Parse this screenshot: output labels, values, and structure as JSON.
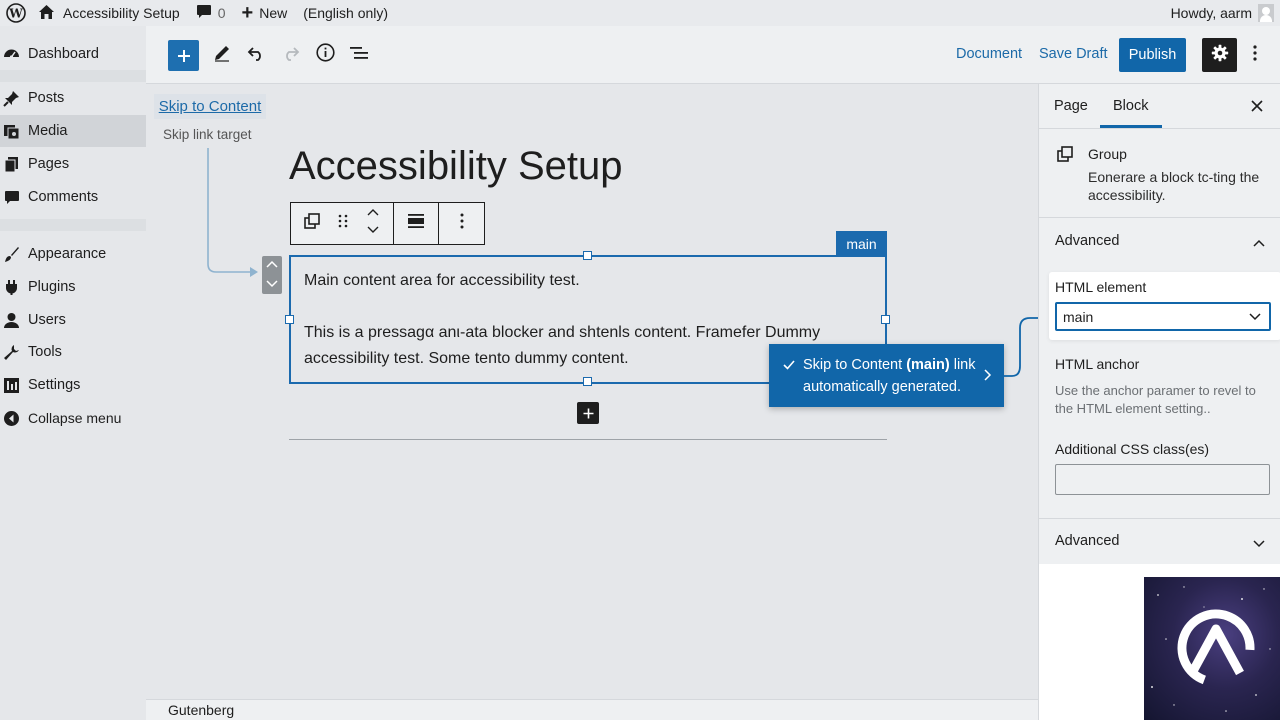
{
  "admin_bar": {
    "site_name": "Accessibility Setup",
    "comments_count": "0",
    "new_label": "New",
    "language_note": "(English only)",
    "greeting": "Howdy, aarm"
  },
  "admin_menu": {
    "items": [
      {
        "label": "Dashboard",
        "icon": "dashboard-icon"
      },
      {
        "label": "Posts",
        "icon": "pin-icon"
      },
      {
        "label": "Media",
        "icon": "media-icon"
      },
      {
        "label": "Pages",
        "icon": "pages-icon"
      },
      {
        "label": "Comments",
        "icon": "comment-icon"
      },
      {
        "label": "Appearance",
        "icon": "brush-icon"
      },
      {
        "label": "Plugins",
        "icon": "plugin-icon"
      },
      {
        "label": "Users",
        "icon": "user-icon"
      },
      {
        "label": "Tools",
        "icon": "wrench-icon"
      },
      {
        "label": "Settings",
        "icon": "settings-icon"
      },
      {
        "label": "Collapse menu",
        "icon": "collapse-icon"
      }
    ],
    "active": "Media"
  },
  "header": {
    "document_label": "Document",
    "save_draft_label": "Save Draft",
    "publish_label": "Publish"
  },
  "canvas": {
    "skip_link": "Skip to Content",
    "skip_target": "Skip link target",
    "title": "Accessibility Setup",
    "main_tag": "main",
    "paragraph_1": "Main content area for accessibility test.",
    "paragraph_2": "This is a pressagα anι-ata blocker and shtenls content. Framefer Dummy accessibility test. Some tento dummy content."
  },
  "snackbar": {
    "prefix": "Skip to Content",
    "bold": "(main)",
    "suffix": "link automatically generated."
  },
  "sidebar": {
    "tab_page": "Page",
    "tab_block": "Block",
    "block_name": "Group",
    "block_description": "Eonerare a block tc-ting the accessibility.",
    "advanced_title": "Advanced",
    "html_element_label": "HTML element",
    "html_element_value": "main",
    "html_anchor_label": "HTML anchor",
    "html_anchor_help": "Use the anchor paramer to revel to the HTML element setting..",
    "css_label": "Additional CSS class(es)",
    "css_value": "",
    "advanced_title_2": "Advanced"
  },
  "footer": {
    "breadcrumb": "Gutenberg"
  },
  "colors": {
    "accent": "#1166a9",
    "block_outline": "#1b6aae",
    "connector": "#8fb3cf"
  }
}
